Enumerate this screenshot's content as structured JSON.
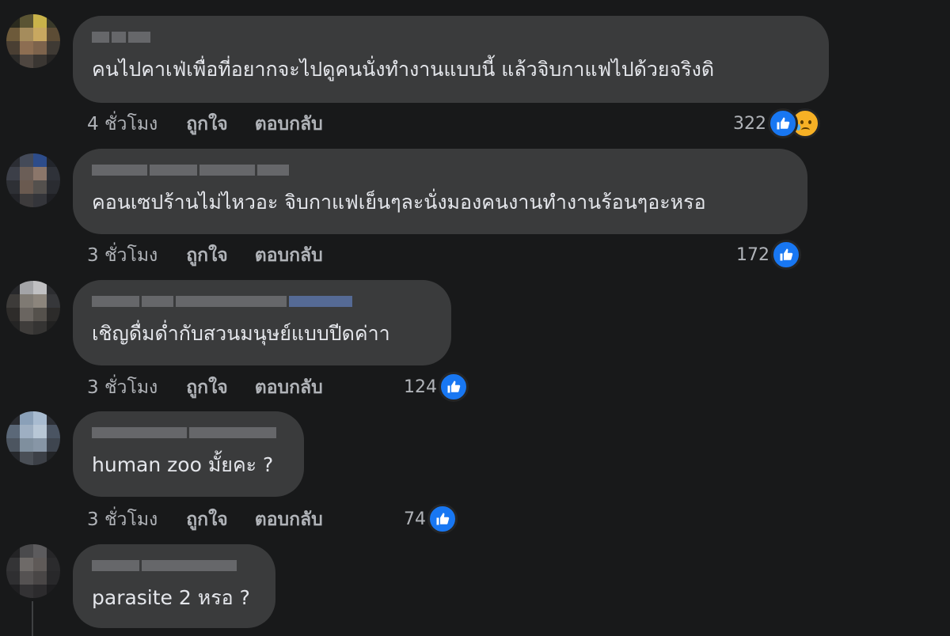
{
  "comments": [
    {
      "text": "คนไปคาเฟ่เพื่อที่อยากจะไปดูคนนั่งทำงานแบบนี้ แล้วจิบกาแฟไปด้วยจริงดิ",
      "time": "4 ชั่วโมง",
      "like_label": "ถูกใจ",
      "reply_label": "ตอบกลับ",
      "reaction_count": "322",
      "reactions": [
        "like-icon",
        "sad-icon"
      ]
    },
    {
      "text": "คอนเซปร้านไม่ไหวอะ จิบกาแฟเย็นๆละนั่งมองคนงานทำงานร้อนๆอะหรอ",
      "time": "3 ชั่วโมง",
      "like_label": "ถูกใจ",
      "reply_label": "ตอบกลับ",
      "reaction_count": "172",
      "reactions": [
        "like-icon"
      ]
    },
    {
      "text": "เชิญดื่มด่ำกับสวนมนุษย์แบบปีดค่าา",
      "time": "3 ชั่วโมง",
      "like_label": "ถูกใจ",
      "reply_label": "ตอบกลับ",
      "reaction_count": "124",
      "reactions": [
        "like-icon"
      ]
    },
    {
      "text": "human zoo มั้ยคะ ?",
      "time": "3 ชั่วโมง",
      "like_label": "ถูกใจ",
      "reply_label": "ตอบกลับ",
      "reaction_count": "74",
      "reactions": [
        "like-icon"
      ]
    },
    {
      "text": "parasite 2 หรอ ?",
      "reactions": []
    }
  ],
  "colors": {
    "background": "#18191a",
    "bubble": "#3a3b3c",
    "primary_text": "#e4e6eb",
    "secondary_text": "#b0b3b8",
    "like_blue": "#1877f2",
    "sad_yellow": "#f7b125"
  }
}
